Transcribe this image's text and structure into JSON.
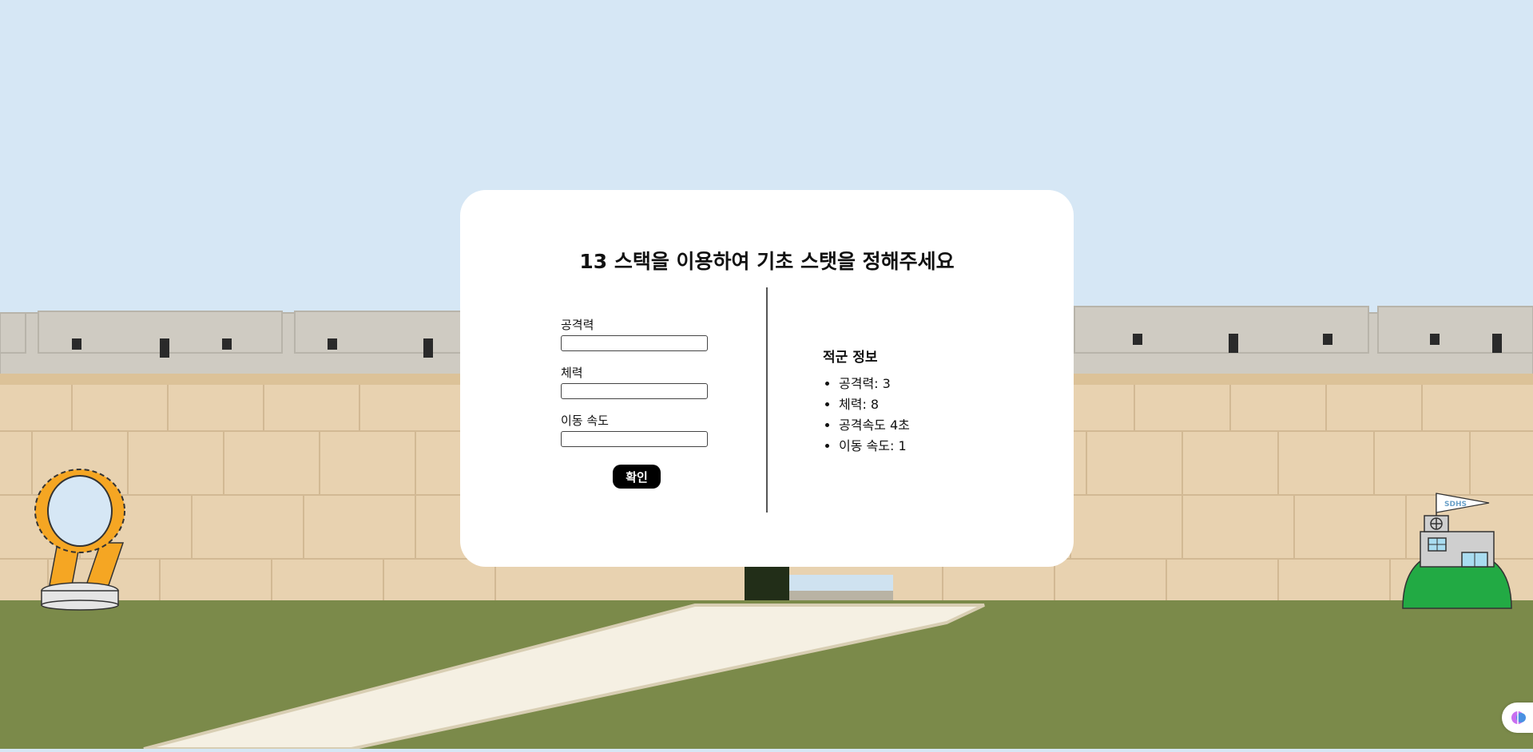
{
  "dialog": {
    "title": "13 스택을 이용하여 기초 스탯을 정해주세요",
    "fields": [
      {
        "label": "공격력",
        "value": ""
      },
      {
        "label": "체력",
        "value": ""
      },
      {
        "label": "이동 속도",
        "value": ""
      }
    ],
    "confirm_label": "확인"
  },
  "enemy_info": {
    "title": "적군 정보",
    "items": [
      "공격력: 3",
      "체력: 8",
      "공격속도 4초",
      "이동 속도: 1"
    ]
  },
  "base": {
    "flag_text": "SDHS"
  },
  "colors": {
    "sky": "#d6e7f5",
    "wall": "#e8d2b0",
    "battlement": "#cfcbc2",
    "grass": "#7b8a4a",
    "path": "#f5f0e3",
    "hill": "#22aa44",
    "portal_gold": "#f5a623"
  }
}
